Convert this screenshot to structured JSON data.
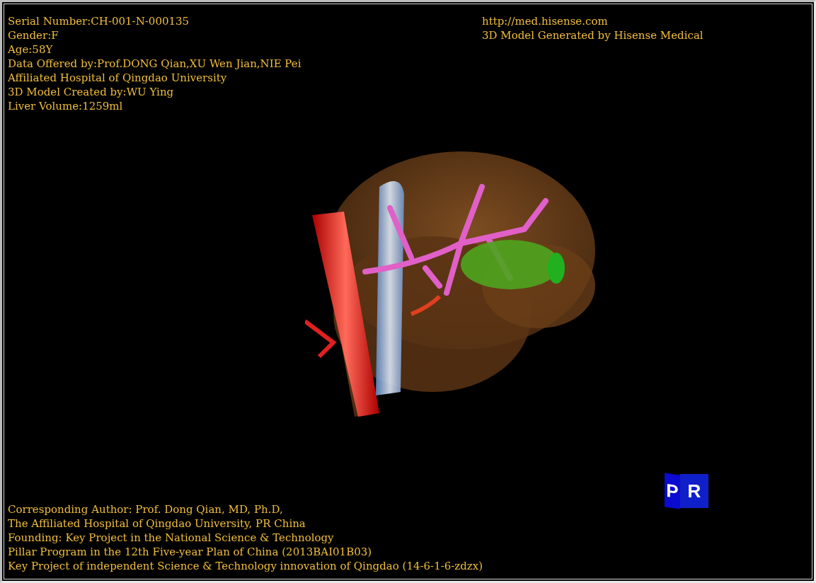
{
  "info_left": [
    "Serial Number:CH-001-N-000135",
    "Gender:F",
    "Age:58Y",
    "Data Offered by:Prof.DONG Qian,XU Wen Jian,NIE Pei",
    "Affiliated Hospital of Qingdao University",
    "3D Model Created by:WU Ying",
    "Liver Volume:1259ml"
  ],
  "info_right": [
    "http://med.hisense.com",
    "3D Model Generated by Hisense Medical"
  ],
  "credits": [
    "Corresponding Author: Prof. Dong Qian, MD, Ph.D,",
    "The Affiliated Hospital of Qingdao University, PR China",
    "Founding: Key Project in the National Science & Technology",
    "Pillar Program in the 12th Five-year Plan of China (2013BAI01B03)",
    "Key Project of independent Science & Technology innovation of Qingdao (14-6-1-6-zdzx)"
  ],
  "orientation_cube": {
    "left_face": "P",
    "front_face": "R"
  }
}
